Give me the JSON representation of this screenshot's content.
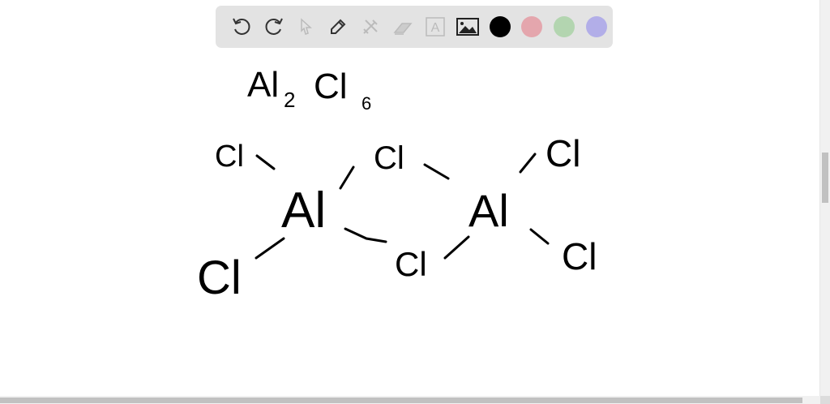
{
  "toolbar": {
    "tools": [
      "undo-icon",
      "redo-icon",
      "select-icon",
      "pen-icon",
      "tools-icon",
      "eraser-icon",
      "text-icon",
      "image-icon"
    ],
    "text_tool_glyph": "A",
    "colors": [
      "#000000",
      "#e4a6ad",
      "#b3d5b0",
      "#b2aee8"
    ]
  },
  "drawing": {
    "formula": {
      "main1": "Al",
      "sub1": "2",
      "main2": "Cl",
      "sub2": "6"
    },
    "atoms": {
      "cl_top_left": "Cl",
      "cl_bridge_top": "Cl",
      "cl_top_right": "Cl",
      "al_left": "Al",
      "al_right": "Al",
      "cl_bottom_left": "Cl",
      "cl_bridge_bottom": "Cl",
      "cl_bottom_right": "Cl"
    }
  }
}
